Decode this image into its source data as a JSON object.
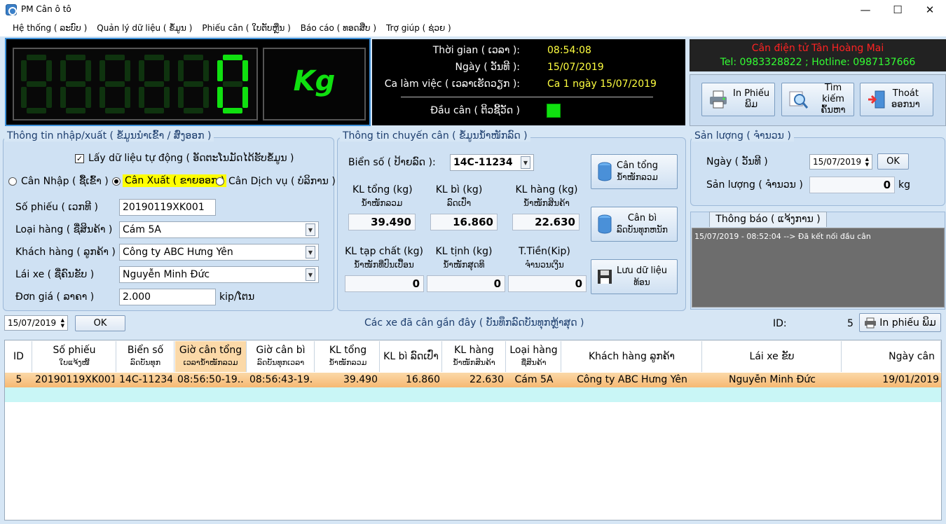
{
  "window": {
    "title": "PM Cân ô tô",
    "minimize": "—",
    "maximize": "☐",
    "close": "✕"
  },
  "menu": [
    "Hệ thống ( ລະບົບ )",
    "Quản lý dữ liệu ( ຂໍ້ມູນ )",
    "Phiếu cân ( ໃບຕັບຫຼືນ )",
    "Báo cáo ( ທອດສືບ )",
    "Trợ giúp ( ຊ່ວຍ )"
  ],
  "scale": {
    "digits": [
      null,
      null,
      null,
      null,
      null,
      "0"
    ],
    "unit": "Kg",
    "colors": {
      "on": "#10e010",
      "off": "#0f330f"
    }
  },
  "info": {
    "time_label": "Thời gian ( ເວລາ ):",
    "time_value": "08:54:08",
    "date_label": "Ngày ( ວັນທີ ):",
    "date_value": "15/07/2019",
    "shift_label": "Ca làm việc ( ເວລາເຮັດວຽກ ):",
    "shift_value": "Ca 1 ngày 15/07/2019",
    "scale_head_label": "Đầu cân ( ຕິວຊີ້ວັດ )"
  },
  "company": {
    "name": "Cân điện tử Tân Hoàng Mai",
    "contact": "Tel: 0983328822 ;  Hotline: 0987137666"
  },
  "toolbar": {
    "print": [
      "In Phiếu",
      "ພິມ"
    ],
    "search": [
      "Tìm kiếm",
      "ຄົ້ນຫາ"
    ],
    "exit": [
      "Thoát",
      "ອອກນາ"
    ]
  },
  "io": {
    "title": "Thông tin nhập/xuất ( ຂໍ້ມູນນຳເຂົ້າ / ສົ່ງອອກ )",
    "auto_label": "Lấy dữ liệu tự động ( ອັດຕະໂນມັດໄດ້ຮັບຂໍ້ມູນ )",
    "radio_in": "Cân Nhập ( ຊື້ເຂົ້າ )",
    "radio_out": "Cân Xuất ( ຂາຍອອກ )",
    "radio_service": "Cân Dịch vụ ( ບໍລິການ )",
    "ticket_label": "Số phiếu ( ເວກທີ )",
    "ticket_value": "20190119XK001",
    "goods_label": "Loại hàng ( ຊື່ສິນຄ້າ )",
    "goods_value": "Cám 5A",
    "customer_label": "Khách hàng ( ລູກຄ້າ )",
    "customer_value": "Công ty ABC Hưng Yên",
    "driver_label": "Lái xe ( ຊື່ຄົນຂັບ )",
    "driver_value": "Nguyễn Minh Đức",
    "price_label": "Đơn giá ( ລາຄາ )",
    "price_value": "2.000",
    "price_unit": "kip/ໂຕນ"
  },
  "trip": {
    "title": "Thông tin chuyến cân ( ຂໍ້ມູນນ້ຳໜັກລົດ )",
    "plate_label": "Biển số ( ປ້າຍລົດ ):",
    "plate_value": "14C-11234",
    "gross_label": [
      "KL tổng (kg)",
      "ນ້ຳໜັກລວມ"
    ],
    "gross_value": "39.490",
    "tare_label": [
      "KL bì (kg)",
      "ລົດເປົ່າ"
    ],
    "tare_value": "16.860",
    "net_label": [
      "KL hàng (kg)",
      "ນ້ຳໜັກສິນຄ້າ"
    ],
    "net_value": "22.630",
    "impurity_label": [
      "KL tạp chất (kg)",
      "ນ້ຳໜັກທີ່ປົນເປື້ອນ"
    ],
    "impurity_value": "0",
    "clean_label": [
      "KL tịnh (kg)",
      "ນ້ຳໜັກສຸດທິ"
    ],
    "clean_value": "0",
    "money_label": [
      "T.Tiền(Kip)",
      "ຈຳນວນເງິນ"
    ],
    "money_value": "0",
    "btn_gross": [
      "Cân tổng",
      "ນ້ຳໜັກລວມ"
    ],
    "btn_tare": [
      "Cân bì",
      "ລົດບັນທຸກຫນັກ"
    ],
    "btn_save": [
      "Lưu dữ liệu",
      "ທ້ອນ"
    ]
  },
  "output": {
    "title": "Sản lượng ( ຈຳນວນ )",
    "date_label": "Ngày ( ວັນທີ )",
    "date_value": "15/07/2019",
    "ok": "OK",
    "qty_label": "Sản lượng ( ຈຳນວນ )",
    "qty_value": "0",
    "qty_unit": "kg"
  },
  "notify": {
    "tab": "Thông báo ( ແຈ້ງການ )",
    "message": "15/07/2019 - 08:52:04 --> Đã kết nối đầu cân"
  },
  "recent": {
    "date_value": "15/07/2019",
    "ok": "OK",
    "title": "Các xe đã cân gần đây ( ບັນທຶກລົດບັນທຸກຫຼ້າສຸດ )",
    "id_label": "ID:",
    "id_value": "5",
    "print_label": "In phiếu ພິມ"
  },
  "table": {
    "headers": [
      [
        "ID",
        ""
      ],
      [
        "Số phiếu",
        "ໃບແຈ້ງໜີ້"
      ],
      [
        "Biển số",
        "ລົດບັນທຸກ"
      ],
      [
        "Giờ cân tổng",
        "ເວລານ້ຳໜັກລວມ"
      ],
      [
        "Giờ cân bì",
        "ລົດບັນທຸກເວລາ"
      ],
      [
        "KL tổng",
        "ນ້ຳໜັກລວມ"
      ],
      [
        "KL bì ລົດເປົ່າ",
        ""
      ],
      [
        "KL hàng",
        "ນ້ຳໜັກສິນຄ້າ"
      ],
      [
        "Loại hàng",
        "ຊື່ສິນຄ້າ"
      ],
      [
        "Khách hàng ລູກຄ້າ",
        ""
      ],
      [
        "Lái xe ຂັບ",
        ""
      ],
      [
        "Ngày cân",
        ""
      ]
    ],
    "rows": [
      [
        "5",
        "20190119XK001",
        "14C-11234",
        "08:56:50-19...",
        "08:56:43-19...",
        "39.490",
        "16.860",
        "22.630",
        "Cám 5A",
        "Công ty ABC Hưng Yên",
        "Nguyễn Minh Đức",
        "19/01/2019"
      ]
    ]
  }
}
